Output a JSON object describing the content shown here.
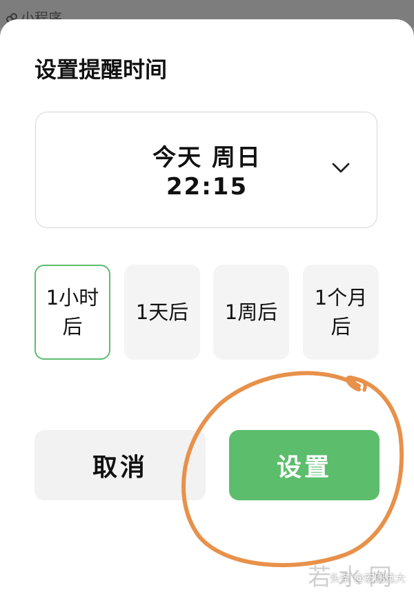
{
  "topbar": {
    "label": "小程序"
  },
  "sheet": {
    "title": "设置提醒时间",
    "picker": {
      "day": "今天 周日",
      "time": "22:15",
      "chevron_icon": "chevron-down-icon"
    },
    "quick_options": [
      {
        "label": "1小时后",
        "selected": true
      },
      {
        "label": "1天后",
        "selected": false
      },
      {
        "label": "1周后",
        "selected": false
      },
      {
        "label": "1个月后",
        "selected": false
      }
    ],
    "buttons": {
      "cancel_label": "取消",
      "set_label": "设置"
    }
  },
  "watermark": {
    "logo": "若水网",
    "source": "头条 @宏图远大"
  },
  "colors": {
    "accent_green": "#5cbd6c",
    "annotation_orange": "#e8914a",
    "option_bg": "#f4f4f4",
    "cancel_bg": "#f2f2f2"
  }
}
